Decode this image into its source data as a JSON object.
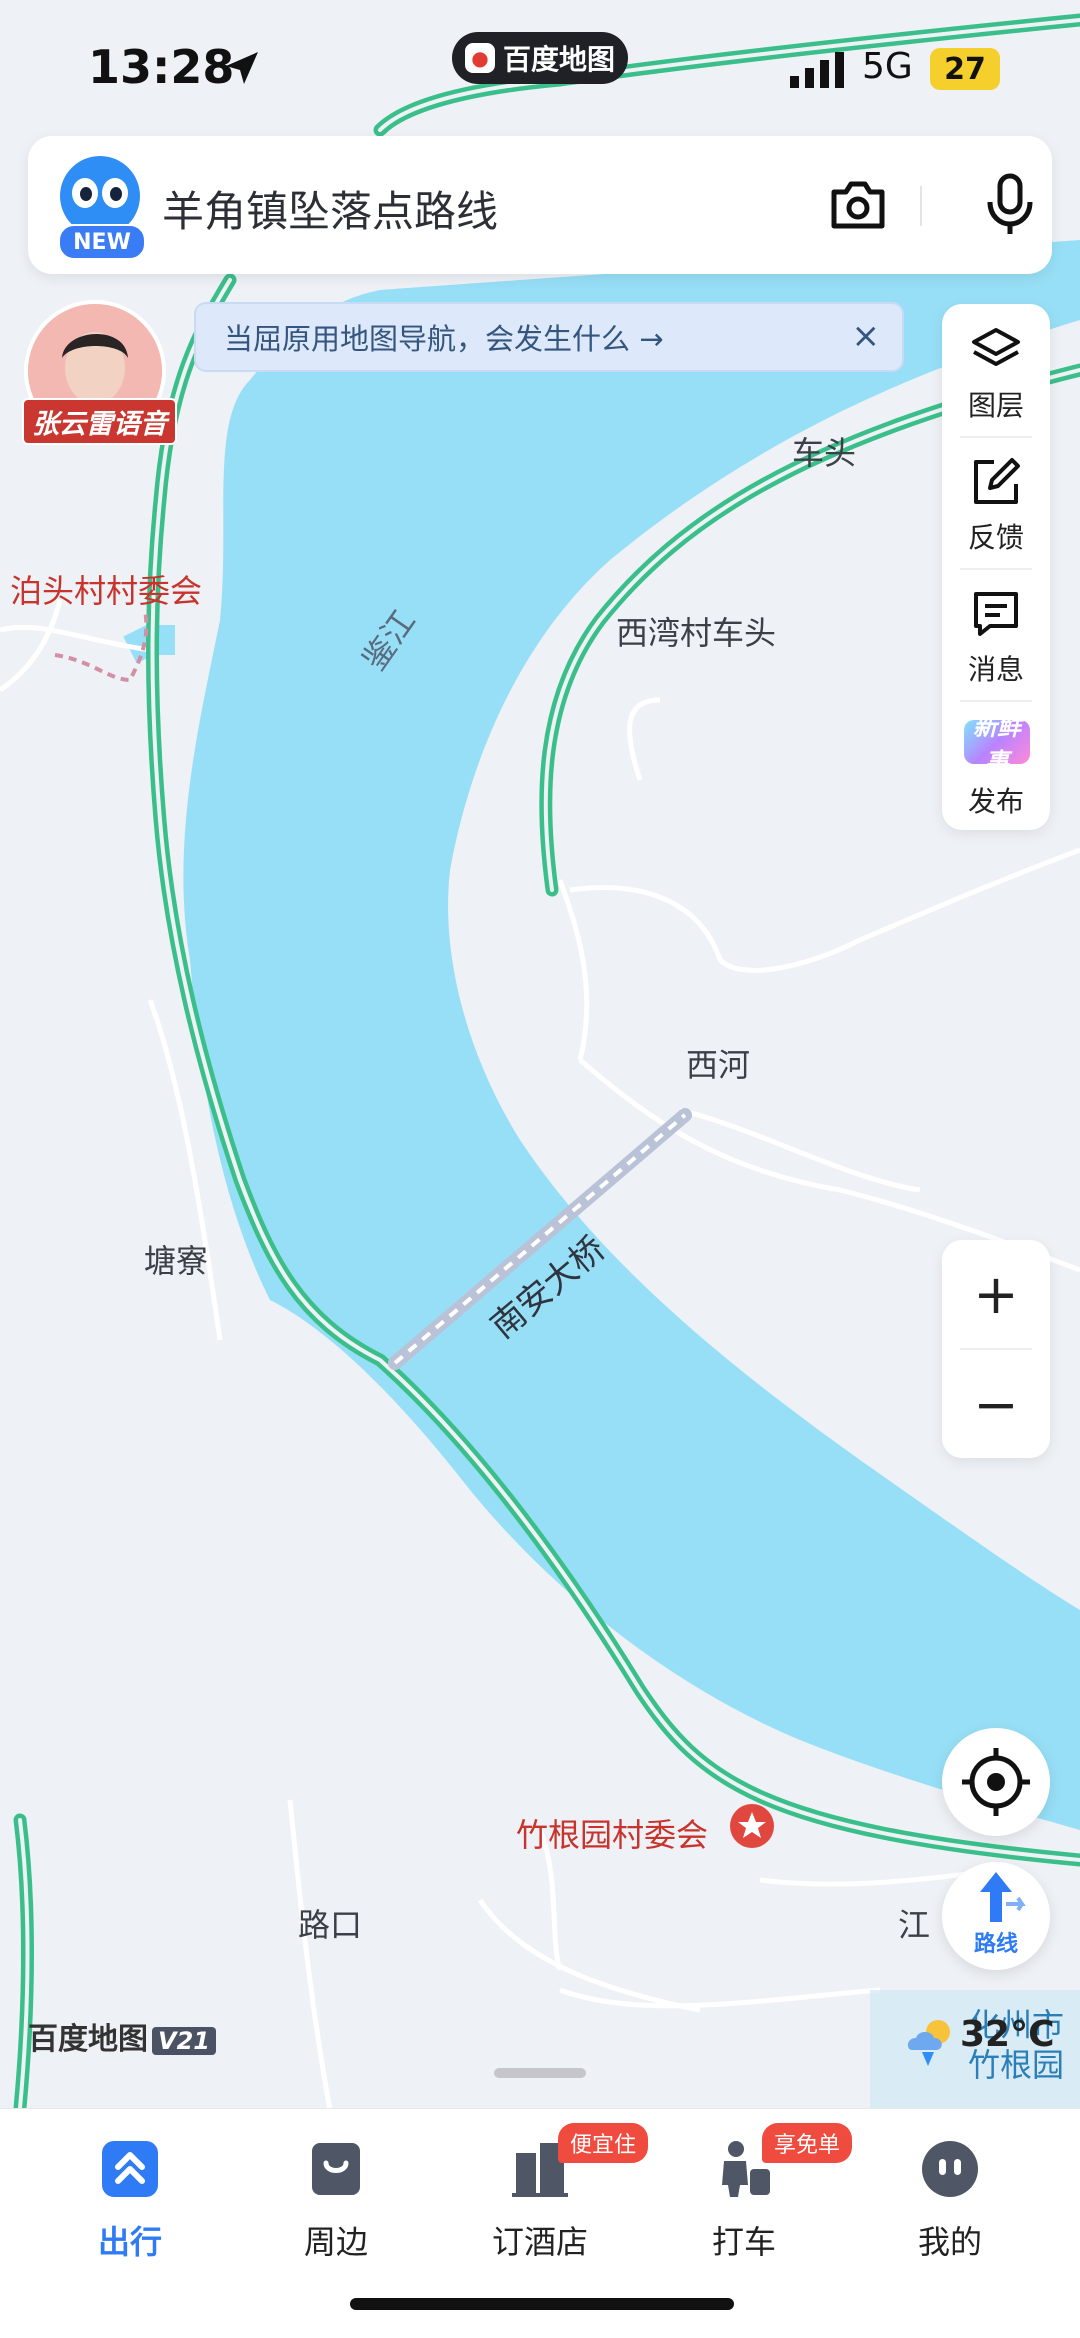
{
  "status_bar": {
    "time": "13:28",
    "app_name": "百度地图",
    "network": "5G",
    "battery": "27"
  },
  "search": {
    "placeholder": "羊角镇坠落点路线",
    "new_badge": "NEW"
  },
  "avatar": {
    "label": "张云雷语音"
  },
  "banner": {
    "text": "当屈原用地图导航，会发生什么 →",
    "close": "×"
  },
  "tools": [
    {
      "name": "layers-icon",
      "label": "图层"
    },
    {
      "name": "feedback-icon",
      "label": "反馈"
    },
    {
      "name": "message-icon",
      "label": "消息"
    },
    {
      "name": "publish-icon",
      "label": "发布",
      "badge": "新鲜事"
    }
  ],
  "zoom": {
    "in": "+",
    "out": "−"
  },
  "route_button": {
    "label": "路线"
  },
  "map_labels": {
    "bo_tou_cun": "泊头村村委会",
    "che_tou": "车头",
    "xi_wan_cun": "西湾村车头",
    "river": "鉴江",
    "xi_he": "西河",
    "tang_liao": "塘寮",
    "bridge": "南安大桥",
    "zhu_gen_yuan": "竹根园村委会",
    "lu_kou": "路口",
    "jiang": "江",
    "zhu_gen_yuan_2": "竹根园",
    "city_partial": "化州市"
  },
  "brand_logo": {
    "text": "百度地图",
    "version": "V21"
  },
  "weather": {
    "temp": "32°C"
  },
  "tabs": [
    {
      "label": "出行",
      "active": true,
      "icon": "travel-icon"
    },
    {
      "label": "周边",
      "active": false,
      "icon": "nearby-icon"
    },
    {
      "label": "订酒店",
      "active": false,
      "icon": "hotel-icon",
      "tag": "便宜住"
    },
    {
      "label": "打车",
      "active": false,
      "icon": "taxi-icon",
      "tag": "享免单"
    },
    {
      "label": "我的",
      "active": false,
      "icon": "profile-icon"
    }
  ],
  "colors": {
    "water": "#97dff6",
    "road_green": "#3bbf8a",
    "accent": "#2f7bf5",
    "land": "#eef1f6"
  }
}
